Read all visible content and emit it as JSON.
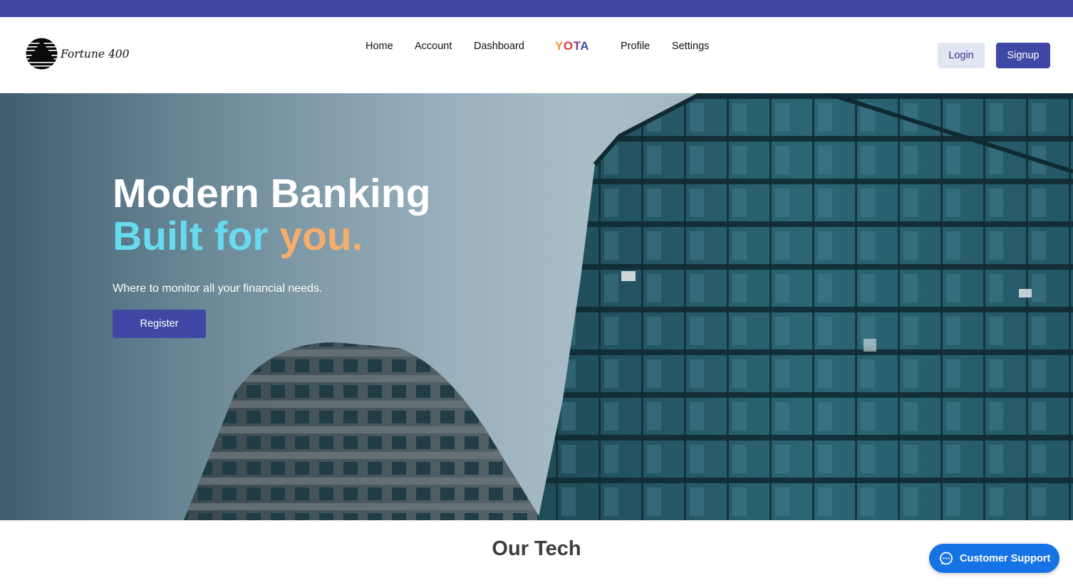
{
  "brand": {
    "name": "Fortune 400",
    "logo_icon": "striped-pyramid-logo"
  },
  "nav": {
    "items": [
      {
        "label": "Home"
      },
      {
        "label": "Account"
      },
      {
        "label": "Dashboard"
      },
      {
        "label": "Profile"
      },
      {
        "label": "Settings"
      }
    ],
    "yota_logo": {
      "letters": [
        "Y",
        "O",
        "T",
        "A"
      ]
    }
  },
  "auth": {
    "login_label": "Login",
    "signup_label": "Signup"
  },
  "hero": {
    "title_line1": "Modern Banking",
    "title_built": "Built for",
    "title_you": "you.",
    "subtitle": "Where to monitor all your financial needs.",
    "register_label": "Register"
  },
  "section": {
    "title": "Our Tech"
  },
  "support": {
    "label": "Customer Support",
    "icon": "chat-bubble-icon"
  },
  "colors": {
    "brand": "#3f48a5",
    "accent_cyan": "#67dbee",
    "accent_orange": "#f4ad6b",
    "support_blue": "#1673e6",
    "login_bg": "#e1e7f2"
  }
}
